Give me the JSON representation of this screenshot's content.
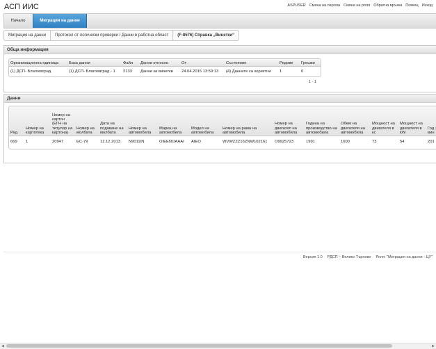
{
  "app": {
    "title": "АСП ИИС"
  },
  "top_links": [
    "ASPUSER",
    "Смяна на парола",
    "Смяна на роля",
    "Обратна връзка",
    "Помощ",
    "Изход"
  ],
  "menu": {
    "home": "Начало",
    "active": "Миграция на данни"
  },
  "breadcrumb": [
    "Миграция на данни",
    "Протокол от логически проверки / Данни в работна област",
    "(F-8576) Справка „Винетки“"
  ],
  "general": {
    "title": "Обща информация",
    "columns": [
      "Организационна единица",
      "База данни",
      "Файл",
      "Данни относно",
      "От",
      "Състояние",
      "Редове",
      "Грешки"
    ],
    "row": [
      "(1) ДСП- Благоевград",
      "(1) ДСП- Благоевград - 1",
      "2133",
      "Данни за винетки",
      "24.04.2015 13:59:13",
      "(4) Данните са коректни",
      "1",
      "0"
    ],
    "pager": "1 - 1"
  },
  "data_panel": {
    "title": "Данни",
    "columns": [
      "Ред",
      "Номер на картотека",
      "Номер на картон (ЕГН на титуляр на картона)",
      "Номер на молбата",
      "Дата на подаване на молбата",
      "Номер на автомобила",
      "Марка на автомобила",
      "Модел на автомобила",
      "Номер на рама на автомобила",
      "Номер на двигател на автомобила",
      "Година на производство на автомобила",
      "Обем на двигателя на автомобила",
      "Мощност на двигателя в кс",
      "Мощност на двигателя в kW",
      "Год за н се к вин"
    ],
    "row": [
      "669",
      "1",
      "20947",
      "ЕС-79",
      "12.12.2013",
      "N9011IN",
      "OIEENOAAAI",
      "AIEO",
      "WVWZZZ16ZNW102161",
      "O9925723",
      "1991",
      "1600",
      "73",
      "54",
      "201"
    ]
  },
  "footer": [
    "Версия 1.0",
    "РДСП – Велико Търново",
    "Роля: \"Миграция на данни - ЦУ\""
  ]
}
